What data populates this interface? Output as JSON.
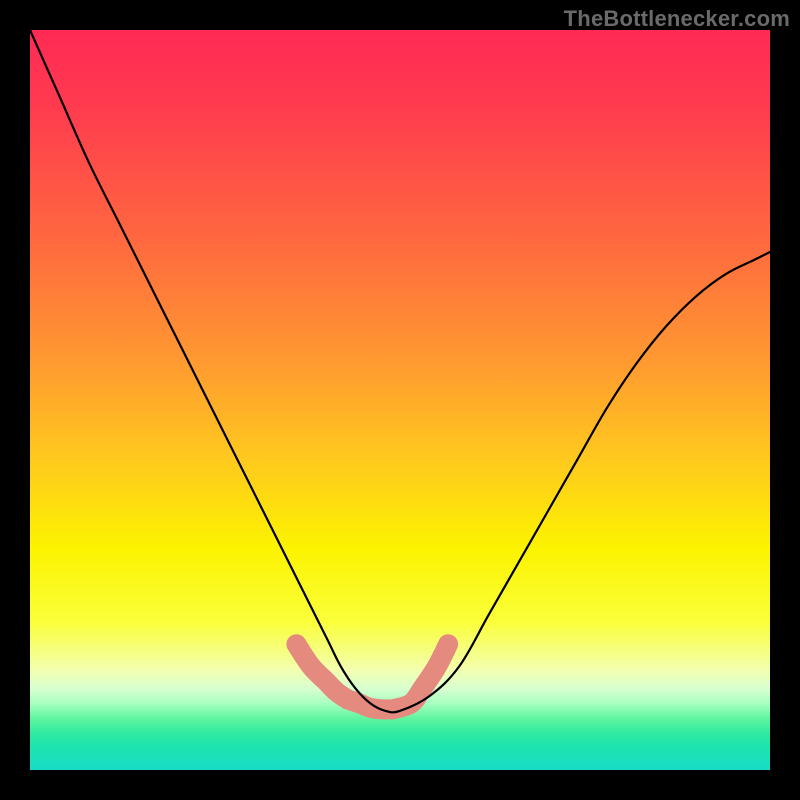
{
  "watermark": {
    "text": "TheBottlenecker.com"
  },
  "colors": {
    "marker": "#e58a7f",
    "curve": "#000000",
    "frame": "#000000"
  },
  "chart_data": {
    "type": "line",
    "title": "",
    "xlabel": "",
    "ylabel": "",
    "xlim": [
      0,
      100
    ],
    "ylim": [
      0,
      100
    ],
    "legend": false,
    "x": [
      0,
      4,
      8,
      12,
      16,
      20,
      24,
      28,
      32,
      36,
      40,
      42,
      44,
      46,
      48,
      50,
      54,
      58,
      62,
      66,
      70,
      74,
      78,
      82,
      86,
      90,
      94,
      98,
      100
    ],
    "series": [
      {
        "name": "bottleneck-curve",
        "values": [
          100,
          91,
          82,
          74,
          66,
          58,
          50,
          42,
          34,
          26,
          18,
          14,
          11,
          9,
          8,
          8,
          10,
          14,
          21,
          28,
          35,
          42,
          49,
          55,
          60,
          64,
          67,
          69,
          70
        ]
      }
    ],
    "markers": {
      "name": "floor-highlight",
      "color": "#e58a7f",
      "points_x": [
        36,
        38,
        40,
        41.5,
        43,
        44.5,
        46,
        47.5,
        49,
        51.5,
        53,
        55,
        56.5
      ],
      "points_y": [
        17,
        14,
        12,
        10.5,
        9.5,
        9,
        8.4,
        8.2,
        8.2,
        9,
        11,
        14,
        17
      ]
    }
  }
}
